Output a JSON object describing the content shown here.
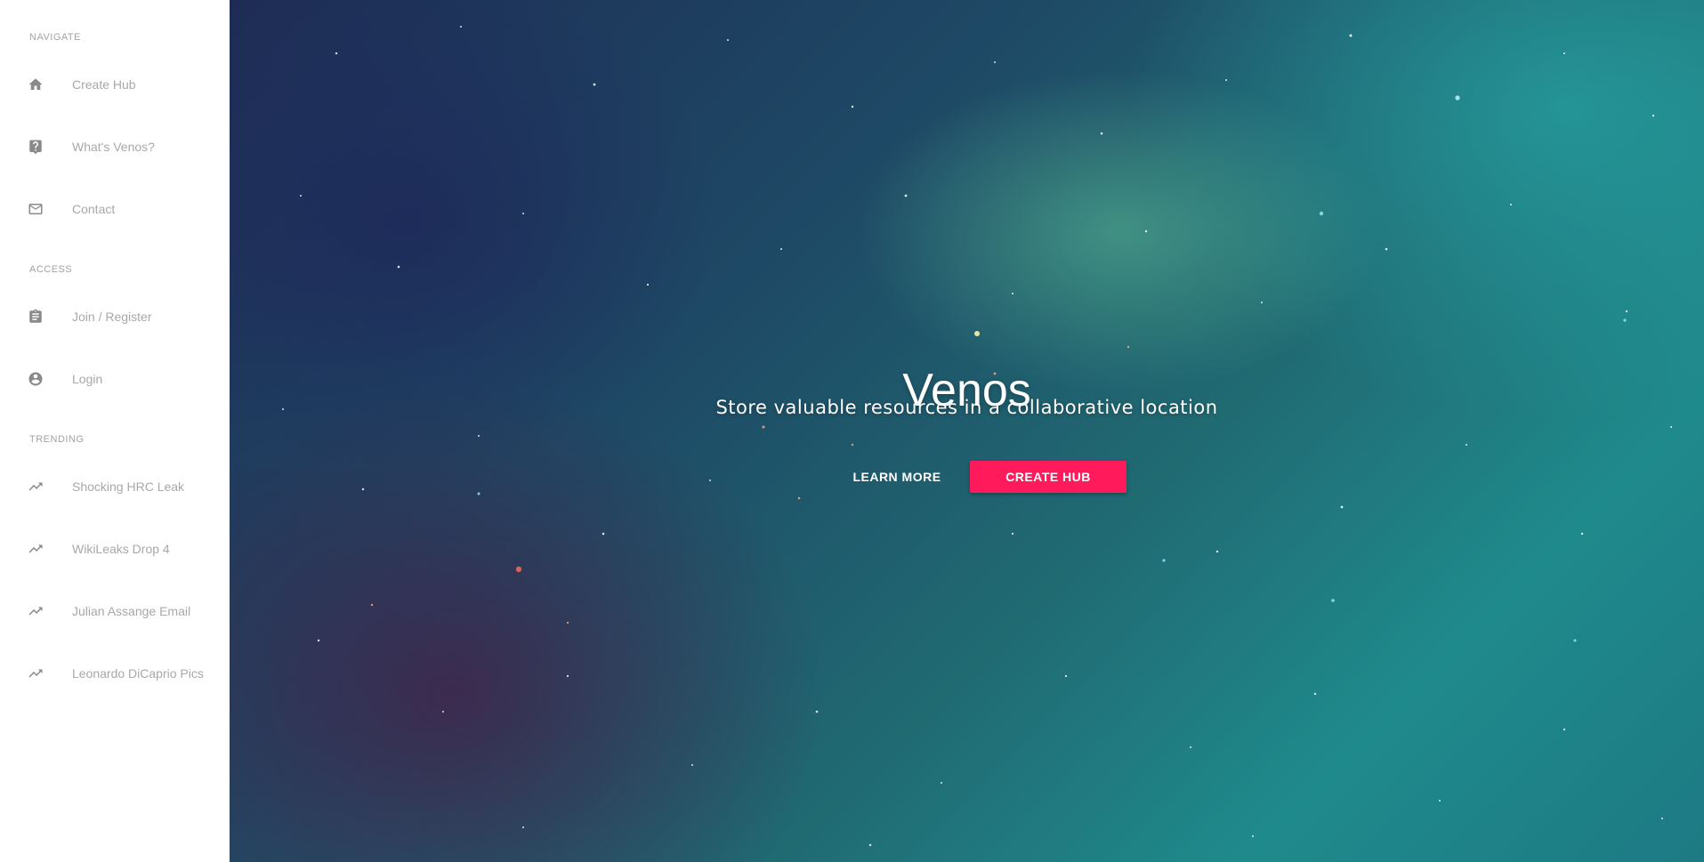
{
  "sidebar": {
    "sections": [
      {
        "header": "NAVIGATE",
        "items": [
          {
            "label": "Create Hub",
            "icon": "home-icon"
          },
          {
            "label": "What's Venos?",
            "icon": "help-icon"
          },
          {
            "label": "Contact",
            "icon": "mail-icon"
          }
        ]
      },
      {
        "header": "ACCESS",
        "items": [
          {
            "label": "Join / Register",
            "icon": "clipboard-icon"
          },
          {
            "label": "Login",
            "icon": "account-circle-icon"
          }
        ]
      },
      {
        "header": "TRENDING",
        "items": [
          {
            "label": "Shocking HRC Leak",
            "icon": "trending-up-icon"
          },
          {
            "label": "WikiLeaks Drop 4",
            "icon": "trending-up-icon"
          },
          {
            "label": "Julian Assange Email",
            "icon": "trending-up-icon"
          },
          {
            "label": "Leonardo DiCaprio Pics",
            "icon": "trending-up-icon"
          }
        ]
      }
    ]
  },
  "hero": {
    "title": "Venos",
    "subtitle": "Store valuable resources in a collaborative location",
    "learn_more_label": "LEARN MORE",
    "create_hub_label": "CREATE HUB"
  },
  "colors": {
    "accent": "#ff1a5c",
    "sidebar_bg": "#ffffff",
    "sidebar_text": "#a8a8a8",
    "icon": "#8a8a8a"
  }
}
